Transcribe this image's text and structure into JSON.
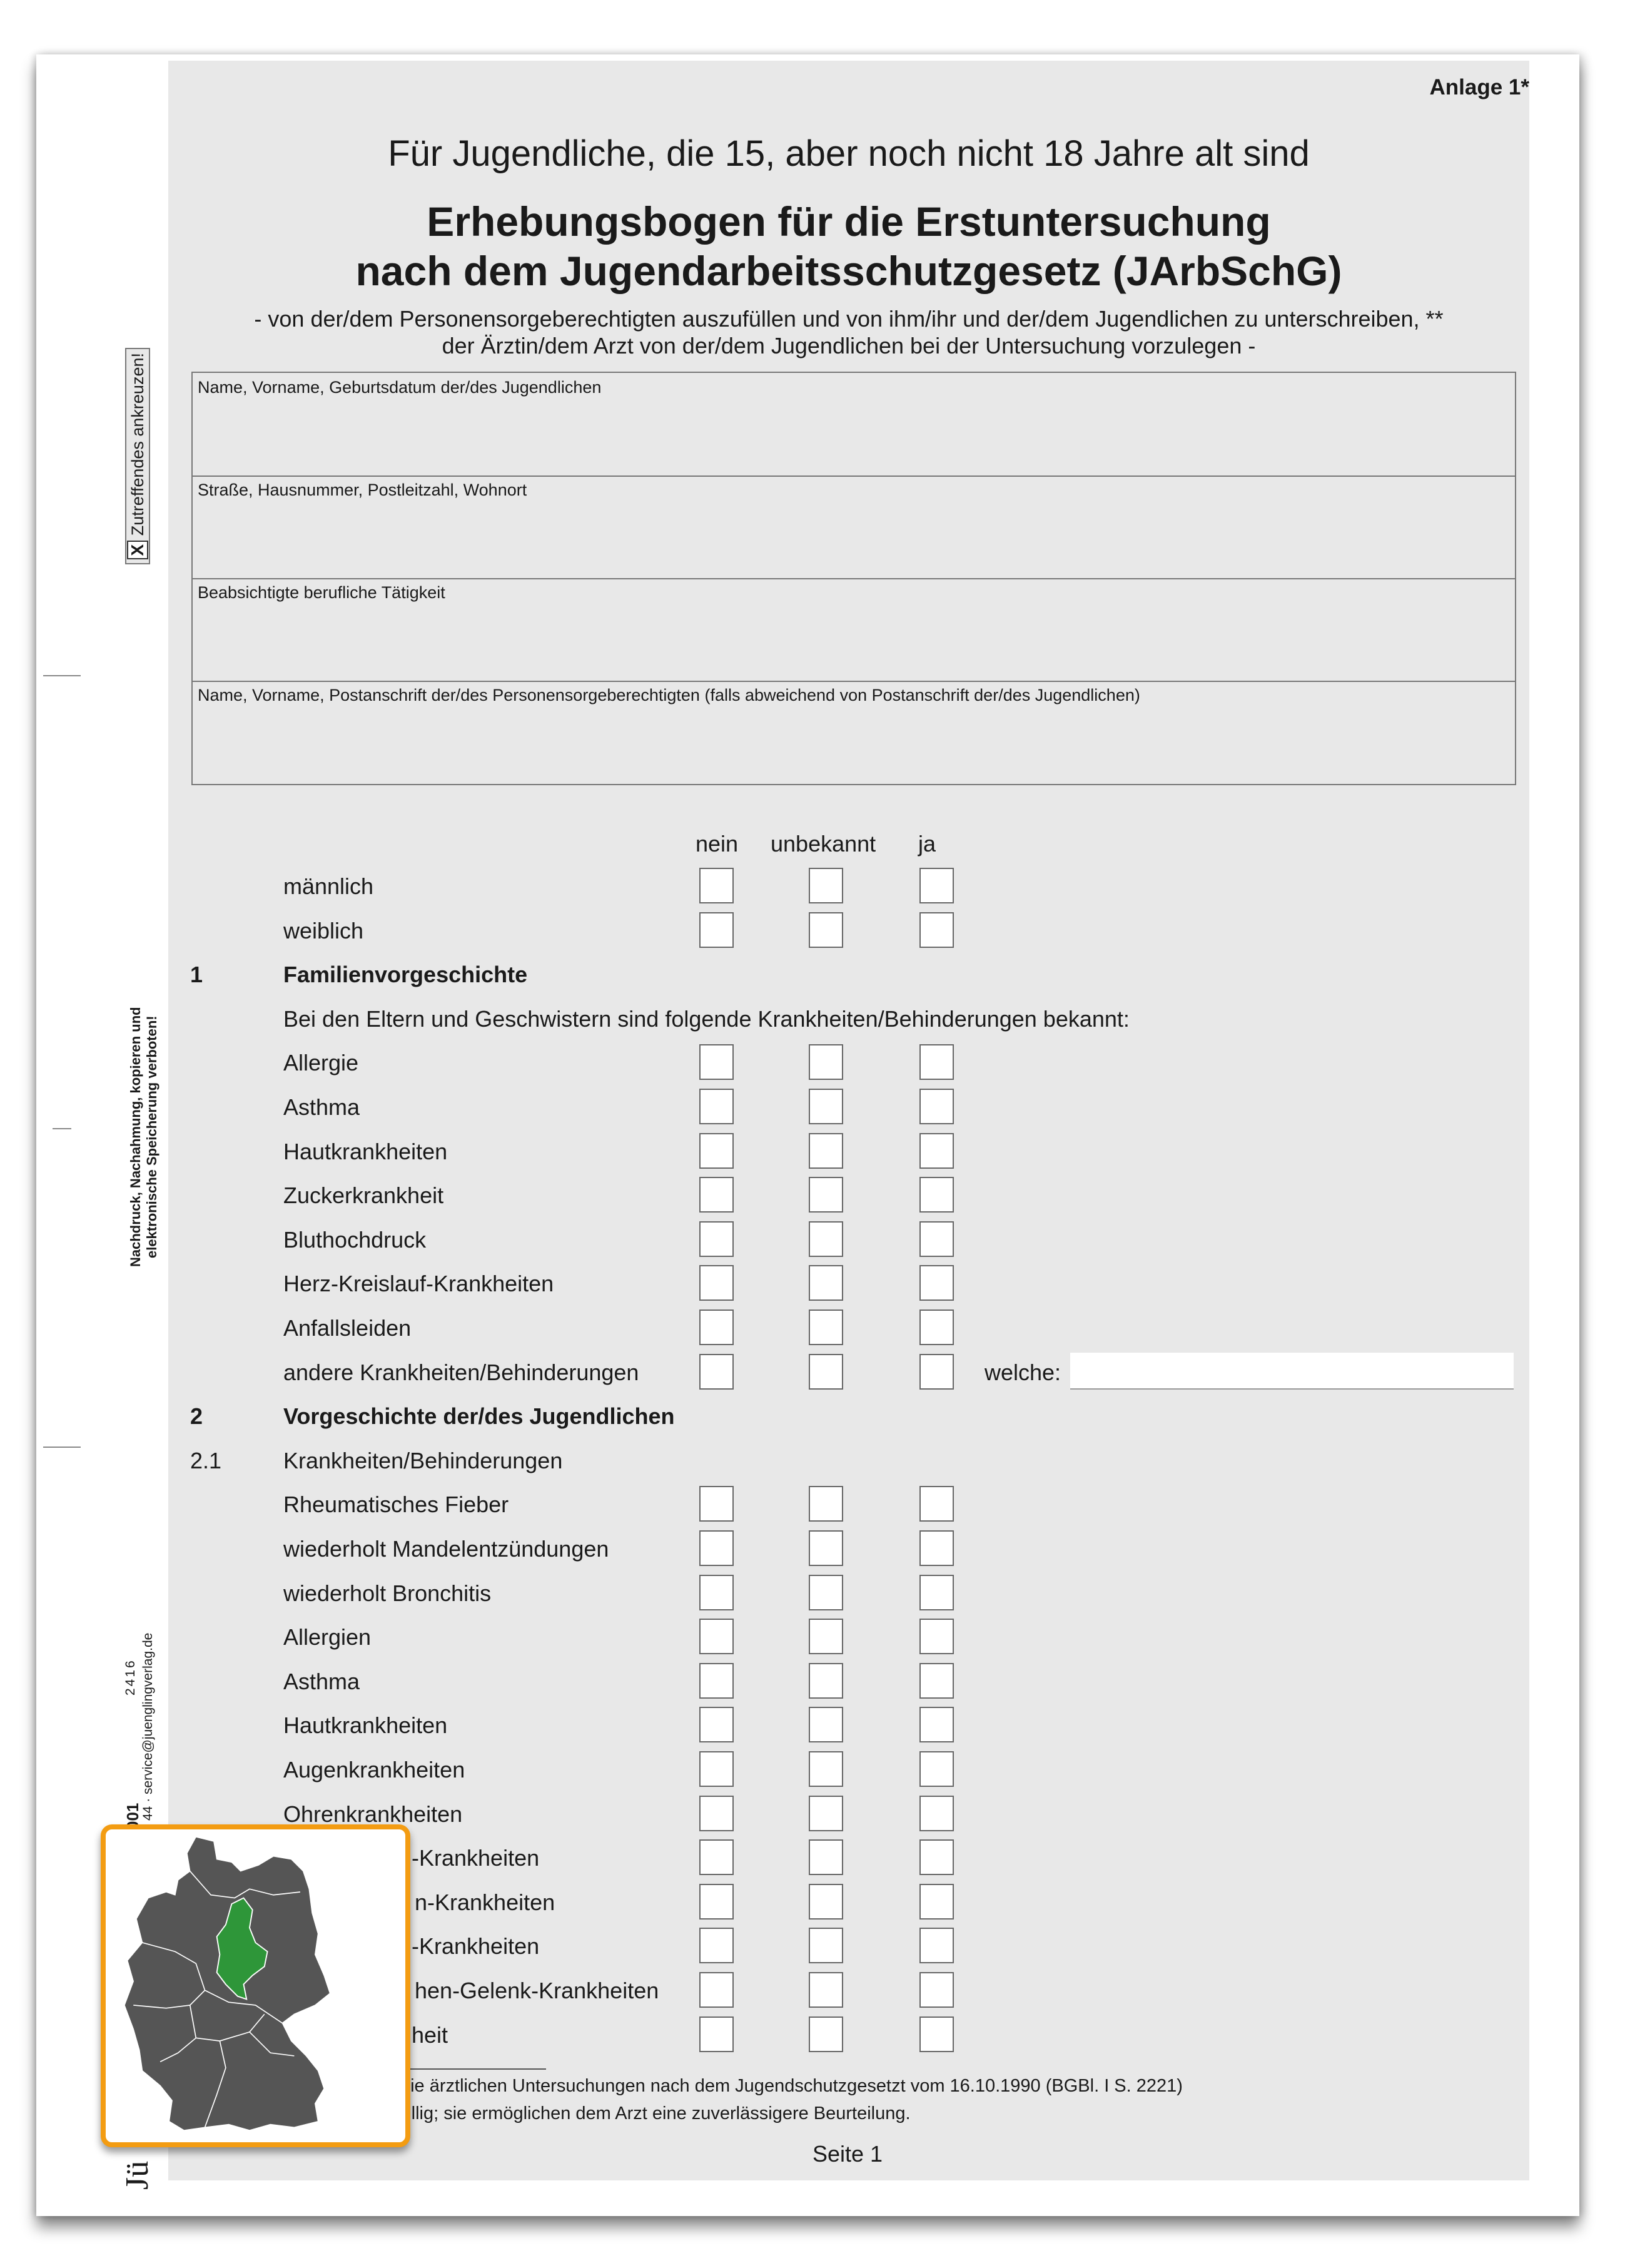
{
  "header": {
    "annex": "Anlage 1*",
    "audience": "Für Jugendliche, die 15, aber noch nicht 18 Jahre alt sind",
    "title_line1": "Erhebungsbogen für die Erstuntersuchung",
    "title_line2": "nach dem Jugendarbeitsschutzgesetz (JArbSchG)",
    "subtitle_line1": "- von der/dem Personensorgeberechtigten auszufüllen und von ihm/ihr und der/dem Jugendlichen zu unterschreiben, **",
    "subtitle_line2": "der Ärztin/dem Arzt von der/dem Jugendlichen bei der Untersuchung vorzulegen -"
  },
  "fields": [
    {
      "label": "Name, Vorname, Geburtsdatum der/des Jugendlichen",
      "value": ""
    },
    {
      "label": "Straße, Hausnummer, Postleitzahl, Wohnort",
      "value": ""
    },
    {
      "label": "Beabsichtigte berufliche Tätigkeit",
      "value": ""
    },
    {
      "label": "Name, Vorname, Postanschrift der/des Personensorgeberechtigten (falls abweichend von Postanschrift der/des Jugendlichen)",
      "value": ""
    }
  ],
  "columns": [
    "nein",
    "unbekannt",
    "ja"
  ],
  "rows": [
    {
      "num": "",
      "label": "männlich",
      "checkboxes": true
    },
    {
      "num": "",
      "label": "weiblich",
      "checkboxes": true
    },
    {
      "num": "1",
      "label": "Familienvorgeschichte",
      "bold": true
    },
    {
      "num": "",
      "label": "Bei den Eltern und Geschwistern sind folgende Krankheiten/Behinderungen bekannt:"
    },
    {
      "num": "",
      "label": "Allergie",
      "checkboxes": true
    },
    {
      "num": "",
      "label": "Asthma",
      "checkboxes": true
    },
    {
      "num": "",
      "label": "Hautkrankheiten",
      "checkboxes": true
    },
    {
      "num": "",
      "label": "Zuckerkrankheit",
      "checkboxes": true
    },
    {
      "num": "",
      "label": "Bluthochdruck",
      "checkboxes": true
    },
    {
      "num": "",
      "label": "Herz-Kreislauf-Krankheiten",
      "checkboxes": true
    },
    {
      "num": "",
      "label": "Anfallsleiden",
      "checkboxes": true
    },
    {
      "num": "",
      "label": "andere Krankheiten/Behinderungen",
      "checkboxes": true,
      "welche": "welche:"
    },
    {
      "num": "2",
      "label": "Vorgeschichte der/des Jugendlichen",
      "bold": true
    },
    {
      "num": "2.1",
      "label": "Krankheiten/Behinderungen"
    },
    {
      "num": "",
      "label": "Rheumatisches Fieber",
      "checkboxes": true
    },
    {
      "num": "",
      "label": "wiederholt Mandelentzündungen",
      "checkboxes": true
    },
    {
      "num": "",
      "label": "wiederholt Bronchitis",
      "checkboxes": true
    },
    {
      "num": "",
      "label": "Allergien",
      "checkboxes": true
    },
    {
      "num": "",
      "label": "Asthma",
      "checkboxes": true
    },
    {
      "num": "",
      "label": "Hautkrankheiten",
      "checkboxes": true
    },
    {
      "num": "",
      "label": "Augenkrankheiten",
      "checkboxes": true
    },
    {
      "num": "",
      "label": "Ohrenkrankheiten",
      "checkboxes": true
    },
    {
      "num": "",
      "label": "-Krankheiten",
      "checkboxes": true,
      "partial": true
    },
    {
      "num": "",
      "label": "n-Krankheiten",
      "checkboxes": true,
      "partial": true
    },
    {
      "num": "",
      "label": "-Krankheiten",
      "checkboxes": true,
      "partial": true
    },
    {
      "num": "",
      "label": "hen-Gelenk-Krankheiten",
      "checkboxes": true,
      "partial": true
    },
    {
      "num": "",
      "label": "heit",
      "checkboxes": true,
      "partial": true
    }
  ],
  "footnotes": [
    "ber die ärztlichen Untersuchungen nach dem Jugendschutzgesetzt vom 16.10.1990 (BGBl. I S. 2221)",
    "freiwillig; sie ermöglichen dem Arzt eine zuverlässigere Beurteilung."
  ],
  "page_label": "Seite 1",
  "margin": {
    "instruction": "Zutreffendes ankreuzen!",
    "instruction_mark": "X",
    "copyright_line1": "Nachdruck, Nachahmung, kopieren und",
    "copyright_line2": "elektronische Speicherung verboten!",
    "code": "2416",
    "contact": "44 · service@juenglingverlag.de",
    "form_number": "001",
    "publisher_fragment": "Jü"
  },
  "map_overlay": {
    "highlight_region": "Sachsen-Anhalt",
    "highlight_color": "#2e9639",
    "base_color": "#555555",
    "border_color": "#f39c12"
  }
}
